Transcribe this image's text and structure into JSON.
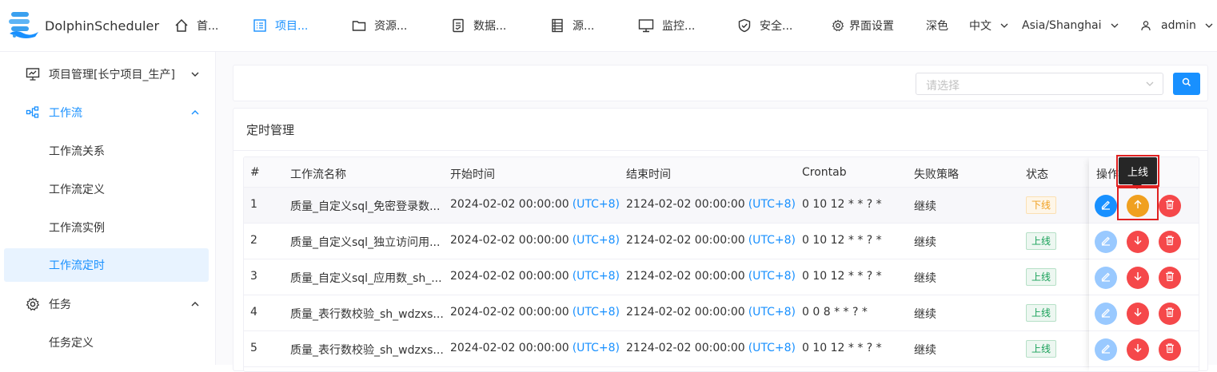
{
  "app": {
    "name": "DolphinScheduler"
  },
  "nav": {
    "items": [
      {
        "label": "首...",
        "icon": "home-icon"
      },
      {
        "label": "项目...",
        "icon": "project-icon",
        "active": true
      },
      {
        "label": "资源...",
        "icon": "folder-icon"
      },
      {
        "label": "数据...",
        "icon": "data-quality-icon"
      },
      {
        "label": "源...",
        "icon": "datasource-icon"
      },
      {
        "label": "监控...",
        "icon": "monitor-icon"
      },
      {
        "label": "安全...",
        "icon": "shield-icon"
      },
      {
        "label": "界面设置",
        "icon": "gear-icon"
      }
    ],
    "theme": "深色",
    "language": "中文",
    "timezone": "Asia/Shanghai",
    "user": "admin"
  },
  "sidebar": {
    "project": "项目管理[长宁项目_生产]",
    "workflow": "工作流",
    "workflow_children": [
      "工作流关系",
      "工作流定义",
      "工作流实例",
      "工作流定时"
    ],
    "task": "任务",
    "task_children": [
      "任务定义"
    ]
  },
  "search": {
    "placeholder": "请选择"
  },
  "card": {
    "title": "定时管理"
  },
  "table": {
    "columns": [
      "#",
      "工作流名称",
      "开始时间",
      "结束时间",
      "Crontab",
      "失败策略",
      "状态",
      "操作"
    ],
    "rows": [
      {
        "index": "1",
        "name": "质量_自定义sql_免密登录数...",
        "start": "2024-02-02 00:00:00",
        "start_tz": "(UTC+8)",
        "end": "2124-02-02 00:00:00",
        "end_tz": "(UTC+8)",
        "crontab": "0 10 12 * * ? *",
        "strategy": "继续",
        "status": "下线"
      },
      {
        "index": "2",
        "name": "质量_自定义sql_独立访问用...",
        "start": "2024-02-02 00:00:00",
        "start_tz": "(UTC+8)",
        "end": "2124-02-02 00:00:00",
        "end_tz": "(UTC+8)",
        "crontab": "0 10 12 * * ? *",
        "strategy": "继续",
        "status": "上线"
      },
      {
        "index": "3",
        "name": "质量_自定义sql_应用数_sh_...",
        "start": "2024-02-02 00:00:00",
        "start_tz": "(UTC+8)",
        "end": "2124-02-02 00:00:00",
        "end_tz": "(UTC+8)",
        "crontab": "0 10 12 * * ? *",
        "strategy": "继续",
        "status": "上线"
      },
      {
        "index": "4",
        "name": "质量_表行数校验_sh_wdzxs...",
        "start": "2024-02-02 00:00:00",
        "start_tz": "(UTC+8)",
        "end": "2124-02-02 00:00:00",
        "end_tz": "(UTC+8)",
        "crontab": "0 0 8 * * ? *",
        "strategy": "继续",
        "status": "上线"
      },
      {
        "index": "5",
        "name": "质量_表行数校验_sh_wdzxs...",
        "start": "2024-02-02 00:00:00",
        "start_tz": "(UTC+8)",
        "end": "2124-02-02 00:00:00",
        "end_tz": "(UTC+8)",
        "crontab": "0 10 12 * * ? *",
        "strategy": "继续",
        "status": "上线"
      }
    ]
  },
  "tooltip": {
    "text": "上线"
  },
  "colors": {
    "primary": "#1890ff",
    "warning": "#f0a020",
    "danger": "#f5484a",
    "success": "#18a058"
  }
}
